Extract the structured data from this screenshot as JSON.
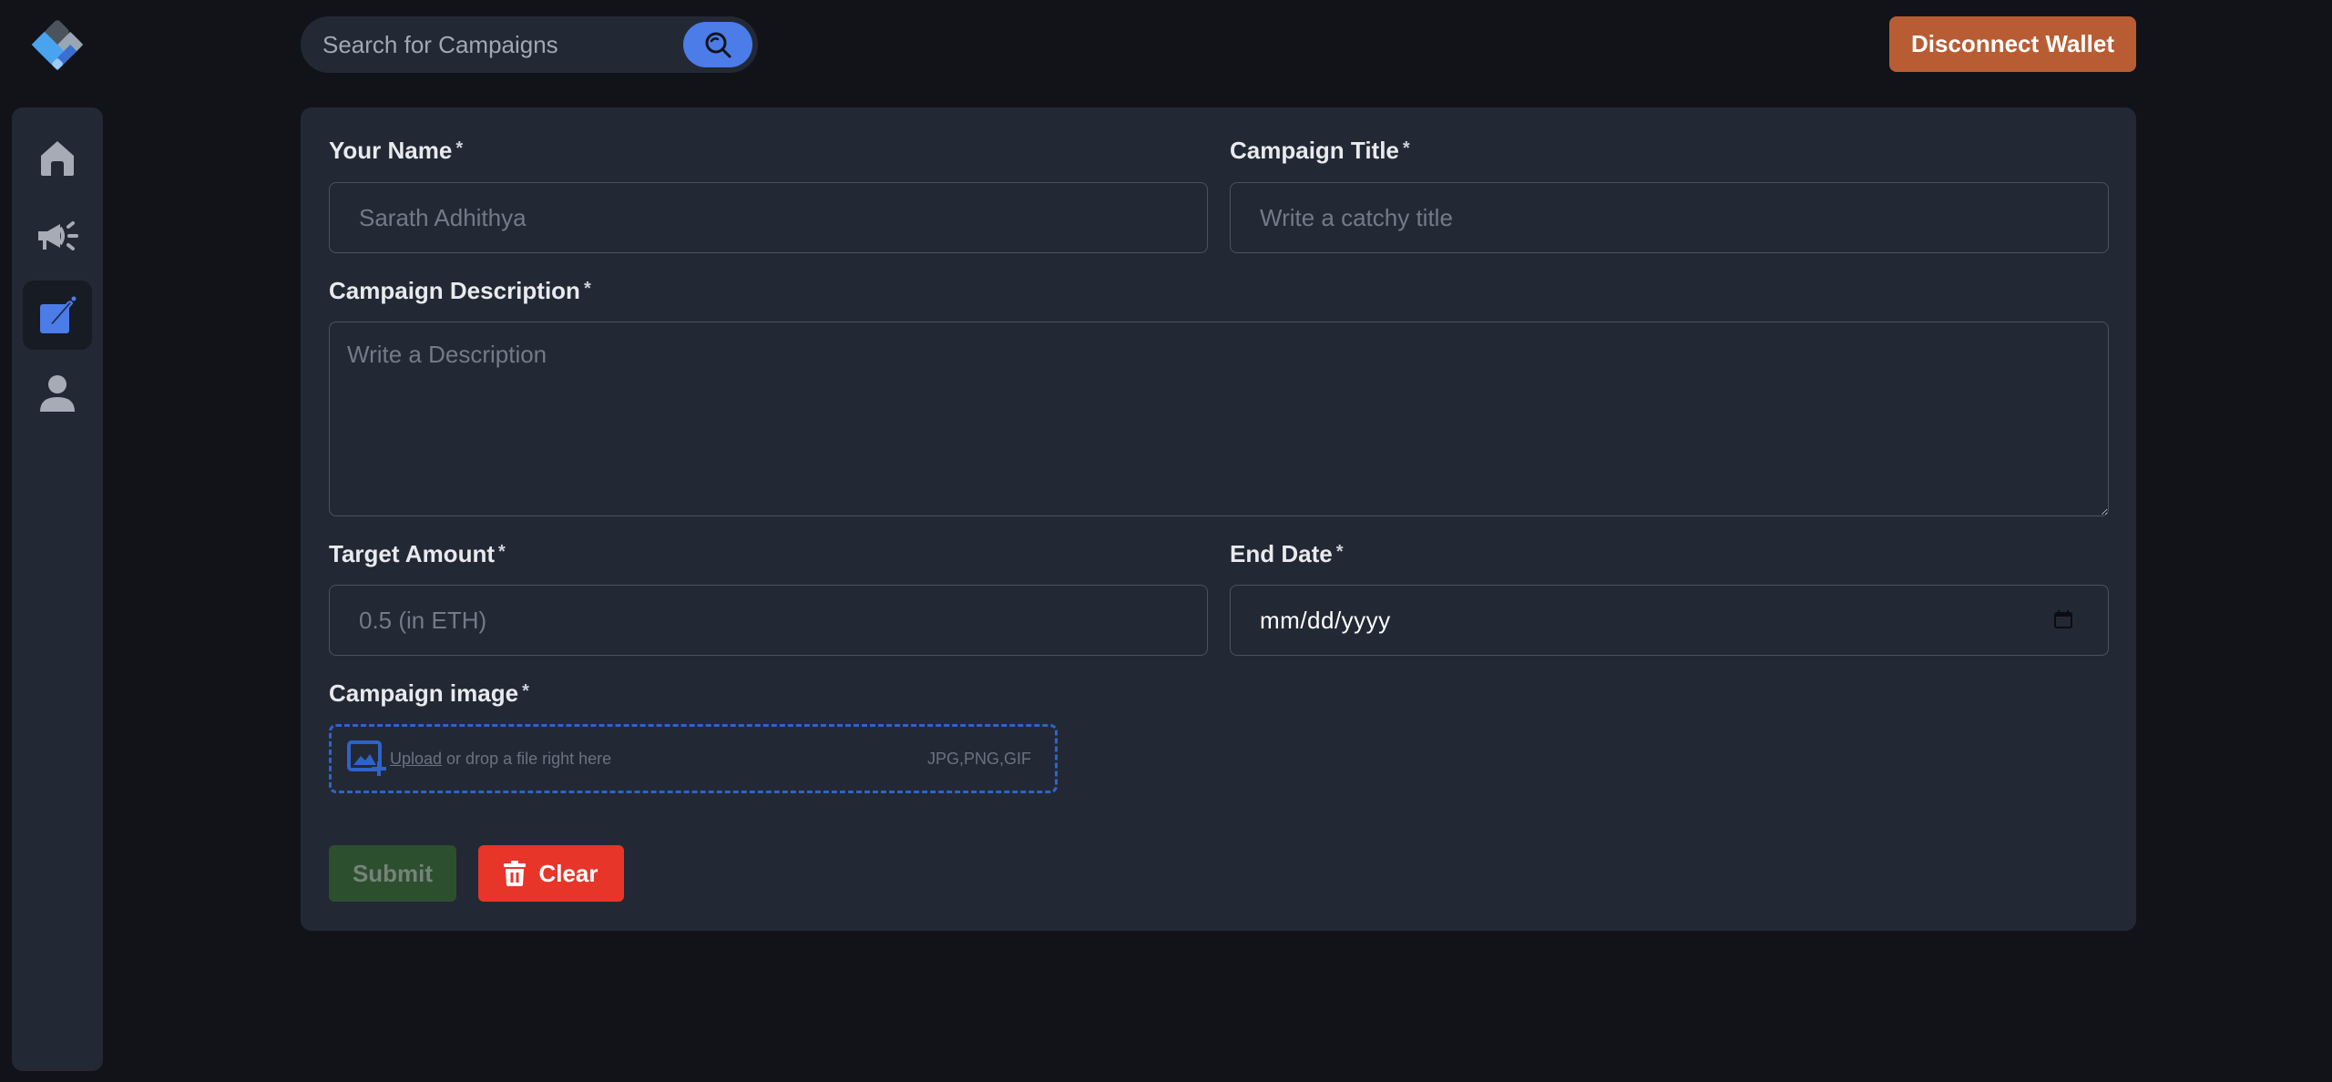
{
  "app": {
    "logo_icon": "diamond-logo-icon"
  },
  "sidebar": {
    "items": [
      {
        "name": "home",
        "icon": "home-icon",
        "active": false
      },
      {
        "name": "campaigns",
        "icon": "megaphone-icon",
        "active": false
      },
      {
        "name": "create-campaign",
        "icon": "edit-icon",
        "active": true
      },
      {
        "name": "profile",
        "icon": "user-icon",
        "active": false
      }
    ]
  },
  "header": {
    "search": {
      "placeholder": "Search for Campaigns",
      "value": "",
      "icon": "search-icon"
    },
    "disconnect_label": "Disconnect Wallet"
  },
  "form": {
    "name": {
      "label": "Your Name",
      "required": "*",
      "placeholder": "Sarath Adhithya",
      "value": ""
    },
    "title": {
      "label": "Campaign Title",
      "required": "*",
      "placeholder": "Write a catchy title",
      "value": ""
    },
    "description": {
      "label": "Campaign Description",
      "required": "*",
      "placeholder": "Write a Description",
      "value": ""
    },
    "target": {
      "label": "Target Amount",
      "required": "*",
      "placeholder": "0.5 (in ETH)",
      "value": ""
    },
    "end_date": {
      "label": "End Date",
      "required": "*",
      "placeholder": "mm/dd/yyyy",
      "icon": "calendar-icon"
    },
    "image": {
      "label": "Campaign image",
      "required": "*",
      "upload_link": "Upload",
      "upload_text": " or drop a file right here",
      "file_types": "JPG,PNG,GIF",
      "icon": "add-image-icon"
    },
    "submit_label": "Submit",
    "clear_label": "Clear"
  },
  "colors": {
    "background": "#111318",
    "panel": "#222935",
    "accent_blue": "#4b7ce8",
    "disconnect": "#b85d33",
    "submit": "#2c4f2e",
    "clear": "#e8352a",
    "upload_border": "#2f63c8"
  }
}
